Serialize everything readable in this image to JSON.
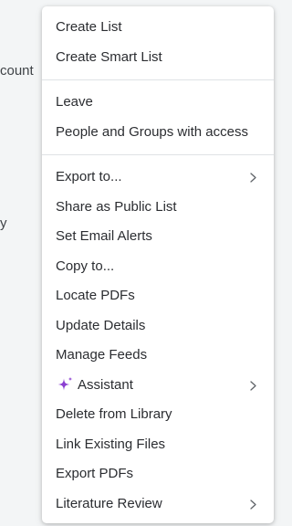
{
  "background": {
    "text_partial_1": "count",
    "text_partial_2": "y"
  },
  "menu": {
    "groups": [
      [
        {
          "label": "Create List"
        },
        {
          "label": "Create Smart List"
        }
      ],
      [
        {
          "label": "Leave"
        },
        {
          "label": "People and Groups with access"
        }
      ],
      [
        {
          "label": "Export to...",
          "submenu": true
        },
        {
          "label": "Share as Public List"
        },
        {
          "label": "Set Email Alerts"
        },
        {
          "label": "Copy to..."
        },
        {
          "label": "Locate PDFs"
        },
        {
          "label": "Update Details"
        },
        {
          "label": "Manage Feeds"
        },
        {
          "label": "Assistant",
          "submenu": true,
          "icon": "sparkle-icon"
        },
        {
          "label": "Delete from Library"
        },
        {
          "label": "Link Existing Files"
        },
        {
          "label": "Export PDFs"
        },
        {
          "label": "Literature Review",
          "submenu": true
        }
      ]
    ]
  },
  "colors": {
    "sparkle": "#8b3fd1",
    "chevron": "#5f6368"
  }
}
